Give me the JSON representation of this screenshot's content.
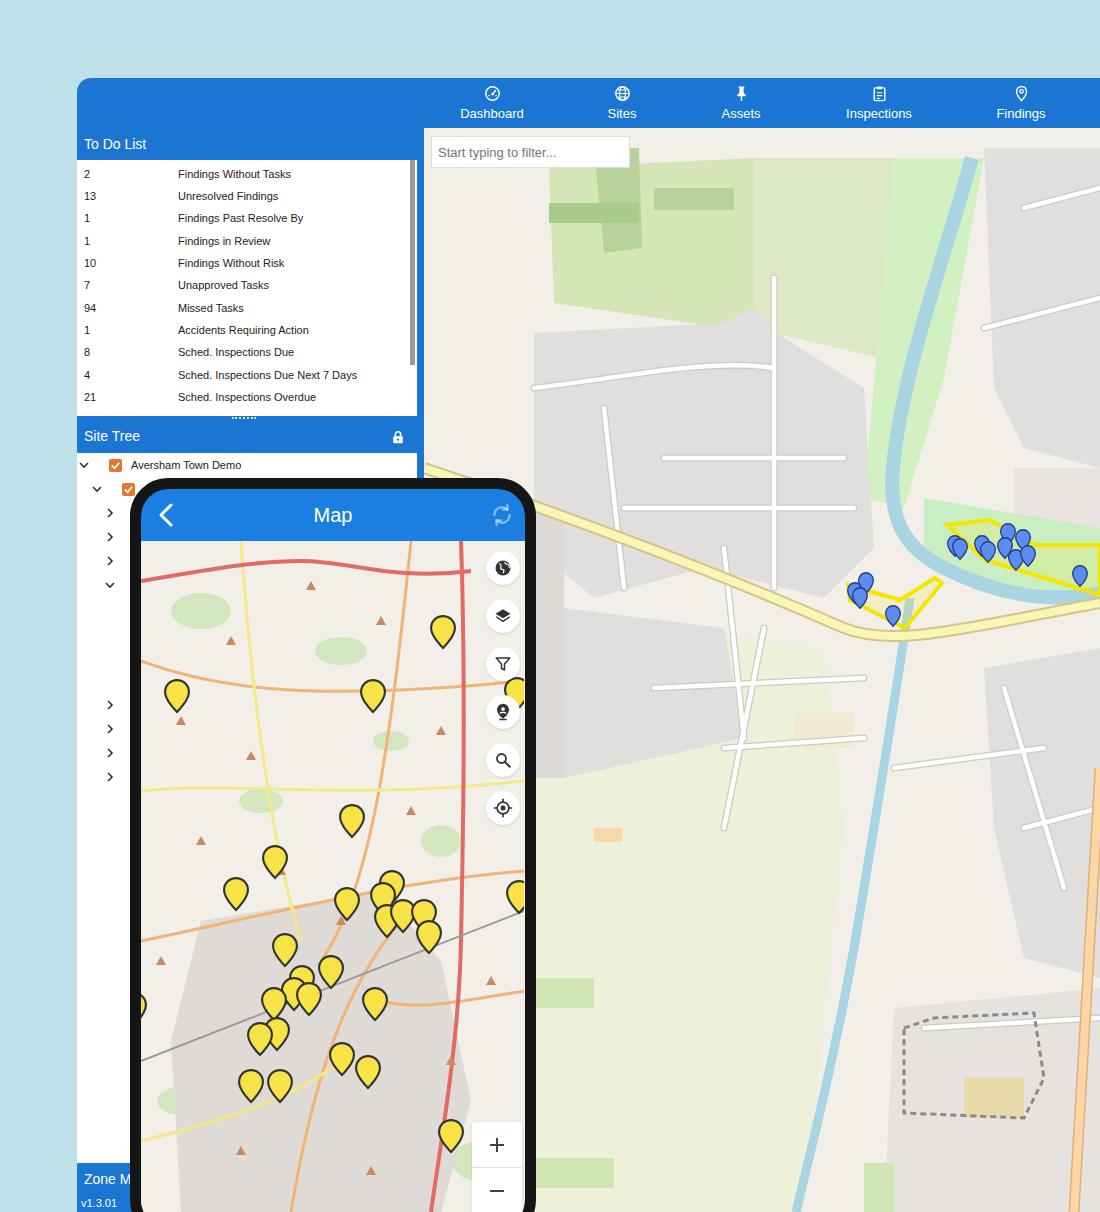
{
  "nav": [
    {
      "label": "Dashboard"
    },
    {
      "label": "Sites"
    },
    {
      "label": "Assets"
    },
    {
      "label": "Inspections"
    },
    {
      "label": "Findings"
    }
  ],
  "todo": {
    "title": "To Do List",
    "items": [
      {
        "count": "2",
        "label": "Findings Without Tasks"
      },
      {
        "count": "13",
        "label": "Unresolved Findings"
      },
      {
        "count": "1",
        "label": "Findings Past Resolve By"
      },
      {
        "count": "1",
        "label": "Findings in Review"
      },
      {
        "count": "10",
        "label": "Findings Without Risk"
      },
      {
        "count": "7",
        "label": "Unapproved Tasks"
      },
      {
        "count": "94",
        "label": "Missed Tasks"
      },
      {
        "count": "1",
        "label": "Accidents Requiring Action"
      },
      {
        "count": "8",
        "label": "Sched. Inspections Due"
      },
      {
        "count": "4",
        "label": "Sched. Inspections Due Next 7 Days"
      },
      {
        "count": "21",
        "label": "Sched. Inspections Overdue"
      }
    ]
  },
  "site_tree": {
    "title": "Site Tree",
    "nodes": [
      {
        "label": "Aversham Town Demo",
        "depth": 0,
        "expanded": true,
        "checked": true
      },
      {
        "depth": 1,
        "expanded": true,
        "checked": true
      },
      {
        "depth": 2,
        "expanded": false
      },
      {
        "depth": 2,
        "expanded": false
      },
      {
        "depth": 2,
        "expanded": false
      },
      {
        "depth": 2,
        "expanded": true
      },
      {
        "depth": 2,
        "expanded": false
      },
      {
        "depth": 2,
        "expanded": false
      },
      {
        "depth": 2,
        "expanded": false
      },
      {
        "depth": 2,
        "expanded": false
      }
    ]
  },
  "zone_panel": {
    "title": "Zone M"
  },
  "version": "v1.3.01",
  "map": {
    "filter": {
      "placeholder": "Start typing to filter..."
    }
  },
  "phone": {
    "title": "Map"
  }
}
